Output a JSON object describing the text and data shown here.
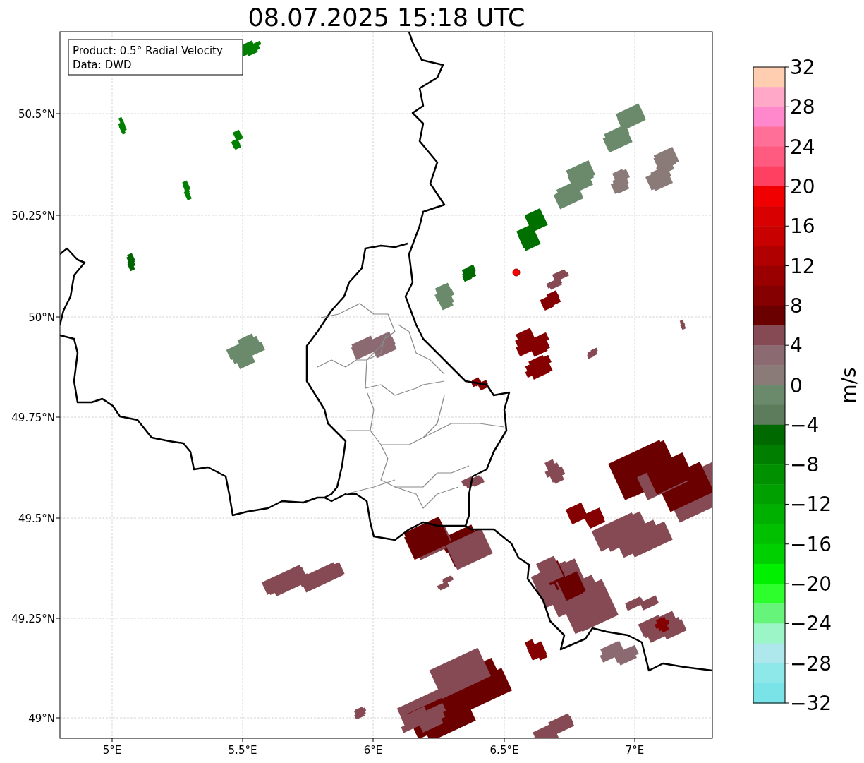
{
  "title": "08.07.2025 15:18 UTC",
  "legend": [
    "Product: 0.5° Radial Velocity",
    "Data: DWD"
  ],
  "map": {
    "xticks": [
      "5°E",
      "5.5°E",
      "6°E",
      "6.5°E",
      "7°E"
    ],
    "yticks": [
      "50.5°N",
      "50.25°N",
      "50°N",
      "49.75°N",
      "49.5°N",
      "49.25°N",
      "49°N"
    ]
  },
  "colorbar": {
    "label": "m/s",
    "ticks": [
      "32",
      "28",
      "24",
      "20",
      "16",
      "12",
      "8",
      "4",
      "0",
      "−4",
      "−8",
      "−12",
      "−16",
      "−20",
      "−24",
      "−28",
      "−32"
    ],
    "bands": [
      {
        "color": "#ffcdb0"
      },
      {
        "color": "#ffa8c8"
      },
      {
        "color": "#ff88cc"
      },
      {
        "color": "#ff6f98"
      },
      {
        "color": "#ff5a80"
      },
      {
        "color": "#ff4060"
      },
      {
        "color": "#f00000"
      },
      {
        "color": "#d80000"
      },
      {
        "color": "#c80000"
      },
      {
        "color": "#b00000"
      },
      {
        "color": "#9a0000"
      },
      {
        "color": "#850000"
      },
      {
        "color": "#6b0000"
      },
      {
        "color": "#864a54"
      },
      {
        "color": "#8c6a72"
      },
      {
        "color": "#8a7a78"
      },
      {
        "color": "#6b8a6b"
      },
      {
        "color": "#5c7c5c"
      },
      {
        "color": "#006a00"
      },
      {
        "color": "#007e00"
      },
      {
        "color": "#009000"
      },
      {
        "color": "#00a000"
      },
      {
        "color": "#00b000"
      },
      {
        "color": "#00c000"
      },
      {
        "color": "#00d000"
      },
      {
        "color": "#00f000"
      },
      {
        "color": "#2dff2d"
      },
      {
        "color": "#66f57a"
      },
      {
        "color": "#9cf5c6"
      },
      {
        "color": "#aee8ec"
      },
      {
        "color": "#8ee8ea"
      },
      {
        "color": "#7ae3e8"
      }
    ]
  }
}
